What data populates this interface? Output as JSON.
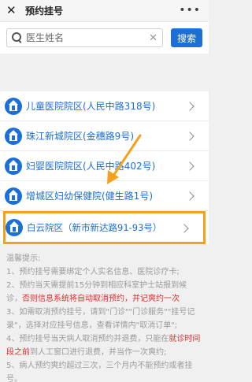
{
  "header": {
    "close_label": "✕",
    "title": "预约挂号",
    "more_label": "•••"
  },
  "search": {
    "placeholder": "医生姓名",
    "clear_label": "✕",
    "button_label": "搜索"
  },
  "campuses": [
    {
      "label": "儿童医院院区(人民中路318号)"
    },
    {
      "label": "珠江新城院区(金穗路9号)"
    },
    {
      "label": "妇婴医院院区(人民中路402号)"
    },
    {
      "label": "增城区妇幼保健院(健生路1号)"
    },
    {
      "label": "白云院区（新市新达路91-93号）"
    }
  ],
  "notes": {
    "title": "温馨提示:",
    "items": [
      {
        "text": "1、预约挂号需要绑定个人实名信息、医院诊疗卡;"
      },
      {
        "pre": "2、预约当天需提前15分钟到相应科室护士站报到候诊，",
        "red": "否则信息系统将自动取消预约，并记爽约一次"
      },
      {
        "text": "3、如需取消预约挂号，请到\"门诊\"\"门诊服务\"\"挂号记录\"，选择对应挂号信息，查看详情内\"取消订单\";"
      },
      {
        "pre": "4、预约挂号当天病人取消预约并退费，只能在",
        "red": "就诊时间段之前",
        "post": "到人工窗口进行退费，并当作一次爽约;"
      },
      {
        "text": "5、病人预约爽约超过三次，三个月内不能预约或者挂号。"
      }
    ]
  },
  "colors": {
    "accent": "#1c6fd6",
    "highlight": "#f4a21b",
    "warning": "#e02d2d"
  }
}
